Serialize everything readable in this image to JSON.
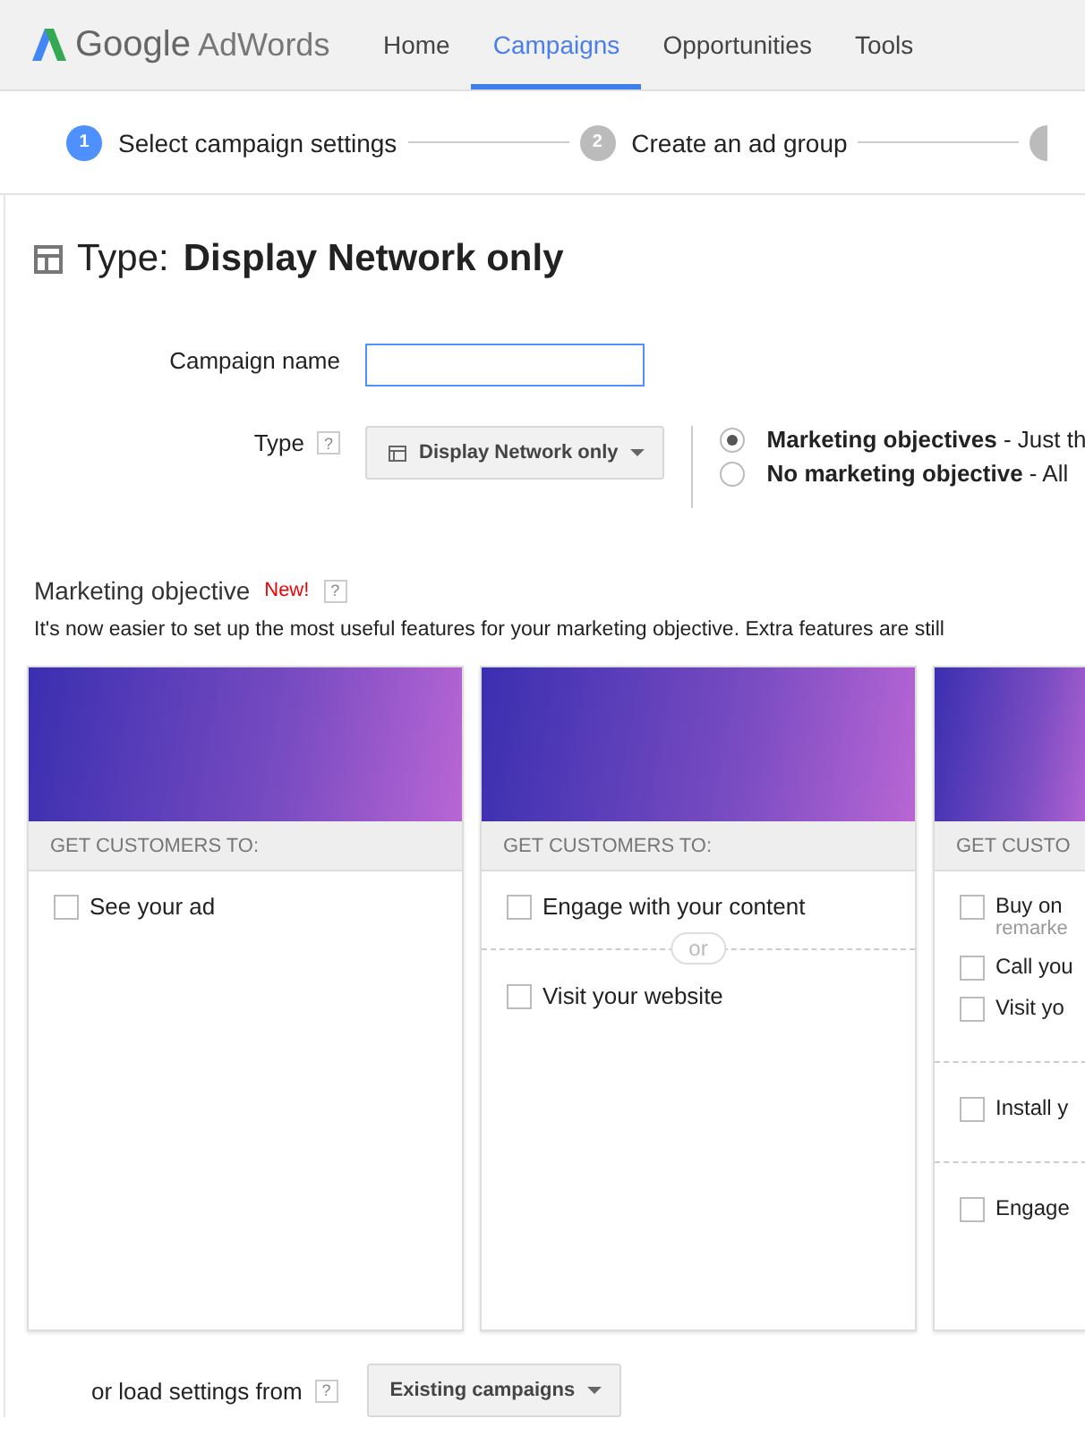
{
  "header": {
    "logo": {
      "brand": "Google",
      "product": "AdWords"
    },
    "nav": [
      {
        "label": "Home",
        "selected": false
      },
      {
        "label": "Campaigns",
        "selected": true
      },
      {
        "label": "Opportunities",
        "selected": false
      },
      {
        "label": "Tools",
        "selected": false
      }
    ]
  },
  "steps": [
    {
      "number": "1",
      "label": "Select campaign settings",
      "selected": true
    },
    {
      "number": "2",
      "label": "Create an ad group",
      "selected": false
    }
  ],
  "title": {
    "prefix": "Type:",
    "value": "Display Network only"
  },
  "form": {
    "campaign_name": {
      "label": "Campaign name"
    },
    "type": {
      "label": "Type",
      "help": "?",
      "dropdown": "Display Network only",
      "options": [
        {
          "bold": "Marketing objectives",
          "rest": " - Just th",
          "selected": true
        },
        {
          "bold": "No marketing objective",
          "rest": " - All",
          "selected": false
        }
      ]
    }
  },
  "objective": {
    "title": "Marketing objective",
    "badge": "New!",
    "help": "?",
    "description": "It's now easier to set up the most useful features for your marketing objective. Extra features are still",
    "cards": [
      {
        "heading": "GET CUSTOMERS TO:",
        "groups": [
          [
            {
              "label": "See your ad",
              "checked": false
            }
          ]
        ]
      },
      {
        "heading": "GET CUSTOMERS TO:",
        "separator": "or",
        "groups": [
          [
            {
              "label": "Engage with your content",
              "checked": false
            }
          ],
          [
            {
              "label": "Visit your website",
              "checked": false
            }
          ]
        ]
      },
      {
        "heading": "GET CUSTO",
        "groups": [
          [
            {
              "label": "Buy on",
              "sub": "remarke",
              "checked": false
            },
            {
              "label": "Call you",
              "checked": false
            },
            {
              "label": "Visit yo",
              "checked": false
            }
          ],
          [
            {
              "label": "Install y",
              "checked": false
            }
          ],
          [
            {
              "label": "Engage",
              "checked": false
            }
          ]
        ]
      }
    ]
  },
  "load": {
    "label": "or load settings from",
    "help": "?",
    "dropdown": "Existing campaigns"
  }
}
